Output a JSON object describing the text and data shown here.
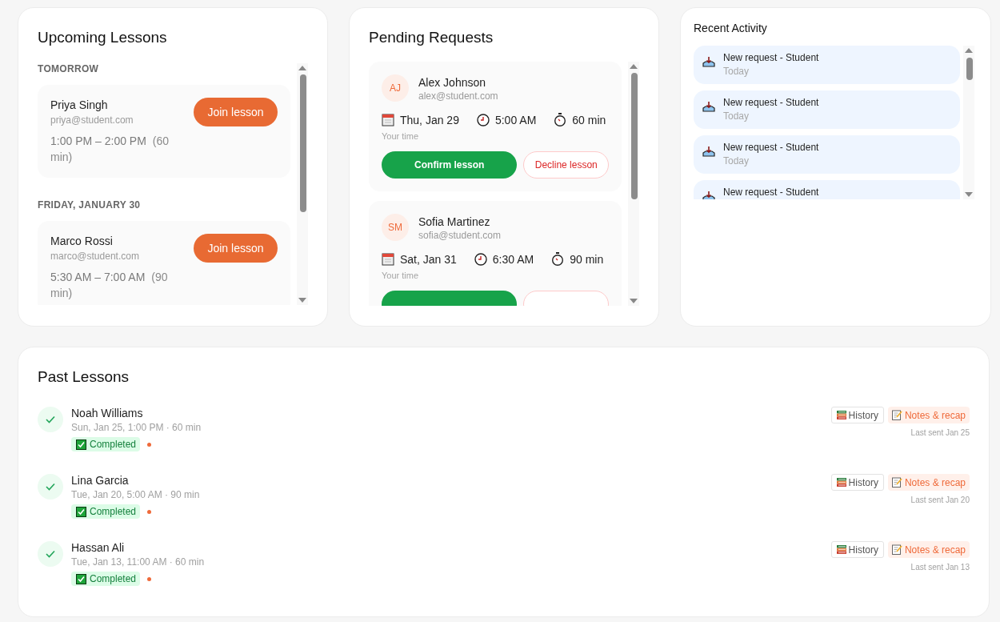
{
  "upcoming": {
    "title": "Upcoming Lessons",
    "groups": [
      {
        "label": "TOMORROW",
        "lessons": [
          {
            "name": "Priya Singh",
            "email": "priya@student.com",
            "time": "1:00 PM – 2:00 PM",
            "duration": "(60 min)",
            "button": "Join lesson"
          }
        ]
      },
      {
        "label": "FRIDAY, JANUARY 30",
        "lessons": [
          {
            "name": "Marco Rossi",
            "email": "marco@student.com",
            "time": "5:30 AM – 7:00 AM",
            "duration": "(90 min)",
            "button": "Join lesson"
          }
        ]
      }
    ]
  },
  "pending": {
    "title": "Pending Requests",
    "requests": [
      {
        "initials": "AJ",
        "name": "Alex Johnson",
        "email": "alex@student.com",
        "date": "Thu, Jan 29",
        "time": "5:00 AM",
        "duration": "60 min",
        "note": "Your time",
        "actions": [
          {
            "kind": "confirm",
            "label": "Confirm lesson"
          },
          {
            "kind": "decline",
            "label": "Decline lesson"
          }
        ]
      },
      {
        "initials": "SM",
        "name": "Sofia Martinez",
        "email": "sofia@student.com",
        "date": "Sat, Jan 31",
        "time": "6:30 AM",
        "duration": "90 min",
        "note": "Your time",
        "actions": [
          {
            "kind": "confirm"
          },
          {
            "kind": "decline"
          }
        ]
      }
    ]
  },
  "activity": {
    "title": "Recent Activity",
    "items": [
      {
        "text": "New request - Student",
        "time": "Today"
      },
      {
        "text": "New request - Student",
        "time": "Today"
      },
      {
        "text": "New request - Student",
        "time": "Today"
      },
      {
        "text": "New request - Student"
      }
    ]
  },
  "past": {
    "title": "Past Lessons",
    "lessons": [
      {
        "name": "Noah Williams",
        "meta": "Sun, Jan 25, 1:00 PM · 60 min",
        "status": {
          "kind": "completed",
          "label": "Completed"
        },
        "unread": true,
        "history": "History",
        "notes": "Notes & recap",
        "last_sent": "Last sent Jan 25"
      },
      {
        "name": "Lina Garcia",
        "meta": "Tue, Jan 20, 5:00 AM · 90 min",
        "status": {
          "kind": "completed",
          "label": "Completed"
        },
        "unread": true,
        "history": "History",
        "notes": "Notes & recap",
        "last_sent": "Last sent Jan 20"
      },
      {
        "name": "Hassan Ali",
        "meta": "Tue, Jan 13, 11:00 AM · 60 min",
        "status": {
          "kind": "completed",
          "label": "Completed"
        },
        "unread": true,
        "history": "History",
        "notes": "Notes & recap",
        "last_sent": "Last sent Jan 13"
      }
    ]
  }
}
